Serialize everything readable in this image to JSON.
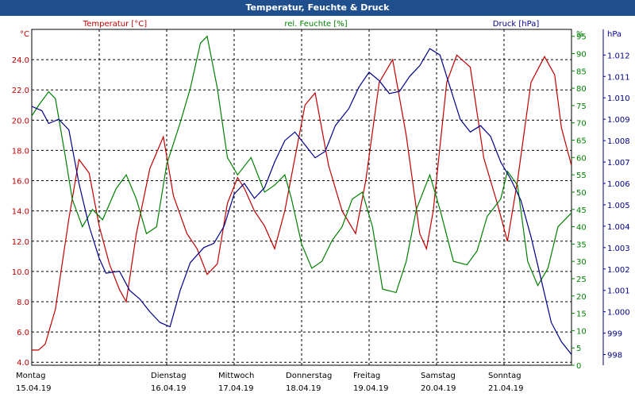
{
  "title": "Temperatur, Feuchte & Druck",
  "chart_data": {
    "type": "line",
    "title": "Temperatur, Feuchte & Druck",
    "axes": {
      "temp": {
        "unit": "°C",
        "label": "Temperatur [°C]",
        "ylim": [
          3.8,
          26.0
        ],
        "ticks": [
          4.0,
          6.0,
          8.0,
          10.0,
          12.0,
          14.0,
          16.0,
          18.0,
          20.0,
          22.0,
          24.0
        ],
        "tick_labels": [
          "4.0",
          "6.0",
          "8.0",
          "10.0",
          "12.0",
          "14.0",
          "16.0",
          "18.0",
          "20.0",
          "22.0",
          "24.0"
        ],
        "color": "#c00000"
      },
      "hum": {
        "unit": "%",
        "label": "rel. Feuchte [%]",
        "ylim": [
          0,
          97
        ],
        "ticks": [
          0,
          5,
          10,
          15,
          20,
          25,
          30,
          35,
          40,
          45,
          50,
          55,
          60,
          65,
          70,
          75,
          80,
          85,
          90,
          95
        ],
        "tick_labels": [
          "0",
          "5",
          "10",
          "15",
          "20",
          "25",
          "30",
          "35",
          "40",
          "45",
          "50",
          "55",
          "60",
          "65",
          "70",
          "75",
          "80",
          "85",
          "90",
          "95"
        ],
        "color": "#008000"
      },
      "press": {
        "unit": "hPa",
        "label": "Druck [hPa]",
        "ylim": [
          997.5,
          1013.2
        ],
        "ticks": [
          998,
          999,
          1000,
          1001,
          1002,
          1003,
          1004,
          1005,
          1006,
          1007,
          1008,
          1009,
          1010,
          1011,
          1012
        ],
        "tick_labels": [
          "998",
          "999",
          "1.000",
          "1.001",
          "1.002",
          "1.003",
          "1.004",
          "1.005",
          "1.006",
          "1.007",
          "1.008",
          "1.009",
          "1.010",
          "1.011",
          "1.012"
        ],
        "color": "#00008b"
      }
    },
    "x_days": [
      {
        "weekday": "Montag",
        "date": "15.04.19"
      },
      {
        "weekday": "Dienstag",
        "date": "16.04.19"
      },
      {
        "weekday": "Mittwoch",
        "date": "17.04.19"
      },
      {
        "weekday": "Donnerstag",
        "date": "18.04.19"
      },
      {
        "weekday": "Freitag",
        "date": "19.04.19"
      },
      {
        "weekday": "Samstag",
        "date": "20.04.19"
      },
      {
        "weekday": "Sonntag",
        "date": "21.04.19"
      }
    ],
    "grid": true,
    "series": [
      {
        "name": "Temperatur [°C]",
        "axis": "temp",
        "color": "#c00000",
        "points": [
          [
            0.0,
            4.8
          ],
          [
            0.1,
            4.8
          ],
          [
            0.2,
            5.2
          ],
          [
            0.35,
            7.5
          ],
          [
            0.55,
            13.5
          ],
          [
            0.7,
            17.4
          ],
          [
            0.85,
            16.5
          ],
          [
            1.0,
            13.0
          ],
          [
            1.15,
            10.5
          ],
          [
            1.3,
            8.8
          ],
          [
            1.4,
            8.0
          ],
          [
            1.55,
            12.5
          ],
          [
            1.75,
            16.8
          ],
          [
            1.95,
            18.9
          ],
          [
            2.1,
            15.0
          ],
          [
            2.3,
            12.5
          ],
          [
            2.45,
            11.5
          ],
          [
            2.6,
            9.8
          ],
          [
            2.75,
            10.5
          ],
          [
            2.9,
            14.5
          ],
          [
            3.05,
            16.2
          ],
          [
            3.15,
            15.5
          ],
          [
            3.3,
            14.0
          ],
          [
            3.45,
            13.0
          ],
          [
            3.6,
            11.5
          ],
          [
            3.75,
            14.0
          ],
          [
            3.9,
            17.5
          ],
          [
            4.05,
            21.0
          ],
          [
            4.2,
            21.8
          ],
          [
            4.4,
            17.0
          ],
          [
            4.6,
            14.0
          ],
          [
            4.8,
            12.5
          ],
          [
            4.95,
            16.0
          ],
          [
            5.15,
            22.5
          ],
          [
            5.35,
            24.0
          ],
          [
            5.55,
            19.0
          ],
          [
            5.75,
            12.5
          ],
          [
            5.85,
            11.5
          ],
          [
            5.95,
            14.0
          ],
          [
            6.15,
            22.5
          ],
          [
            6.3,
            24.3
          ],
          [
            6.5,
            23.5
          ],
          [
            6.7,
            17.5
          ],
          [
            6.9,
            14.5
          ],
          [
            7.05,
            12.0
          ],
          [
            7.2,
            16.0
          ],
          [
            7.4,
            22.5
          ],
          [
            7.6,
            24.2
          ],
          [
            7.75,
            23.0
          ],
          [
            7.85,
            19.5
          ],
          [
            8.0,
            17.0
          ]
        ]
      },
      {
        "name": "rel. Feuchte [%]",
        "axis": "hum",
        "color": "#008000",
        "points": [
          [
            0.0,
            72
          ],
          [
            0.1,
            75
          ],
          [
            0.25,
            79
          ],
          [
            0.35,
            77
          ],
          [
            0.5,
            60
          ],
          [
            0.6,
            48
          ],
          [
            0.75,
            40
          ],
          [
            0.9,
            45
          ],
          [
            1.05,
            42
          ],
          [
            1.25,
            51
          ],
          [
            1.4,
            55
          ],
          [
            1.55,
            48
          ],
          [
            1.7,
            38
          ],
          [
            1.85,
            40
          ],
          [
            2.0,
            58
          ],
          [
            2.2,
            70
          ],
          [
            2.35,
            80
          ],
          [
            2.5,
            93
          ],
          [
            2.6,
            95
          ],
          [
            2.75,
            80
          ],
          [
            2.9,
            60
          ],
          [
            3.05,
            55
          ],
          [
            3.25,
            60
          ],
          [
            3.45,
            50
          ],
          [
            3.6,
            52
          ],
          [
            3.75,
            55
          ],
          [
            3.85,
            48
          ],
          [
            4.0,
            35
          ],
          [
            4.15,
            28
          ],
          [
            4.3,
            30
          ],
          [
            4.45,
            36
          ],
          [
            4.6,
            40
          ],
          [
            4.75,
            48
          ],
          [
            4.9,
            50
          ],
          [
            5.05,
            40
          ],
          [
            5.2,
            22
          ],
          [
            5.4,
            21
          ],
          [
            5.55,
            30
          ],
          [
            5.7,
            45
          ],
          [
            5.9,
            55
          ],
          [
            6.05,
            45
          ],
          [
            6.25,
            30
          ],
          [
            6.45,
            29
          ],
          [
            6.6,
            33
          ],
          [
            6.75,
            43
          ],
          [
            6.95,
            48
          ],
          [
            7.05,
            56
          ],
          [
            7.2,
            52
          ],
          [
            7.35,
            30
          ],
          [
            7.5,
            23
          ],
          [
            7.65,
            28
          ],
          [
            7.8,
            40
          ],
          [
            8.0,
            44
          ]
        ]
      },
      {
        "name": "Druck [hPa]",
        "axis": "press",
        "color": "#00008b",
        "points": [
          [
            0.0,
            1009.6
          ],
          [
            0.15,
            1009.4
          ],
          [
            0.25,
            1008.8
          ],
          [
            0.4,
            1009.0
          ],
          [
            0.55,
            1008.5
          ],
          [
            0.7,
            1006.0
          ],
          [
            0.85,
            1004.0
          ],
          [
            1.0,
            1002.5
          ],
          [
            1.1,
            1001.8
          ],
          [
            1.3,
            1001.9
          ],
          [
            1.45,
            1001.0
          ],
          [
            1.6,
            1000.6
          ],
          [
            1.75,
            1000.0
          ],
          [
            1.9,
            999.5
          ],
          [
            2.05,
            999.3
          ],
          [
            2.2,
            1001.0
          ],
          [
            2.35,
            1002.3
          ],
          [
            2.55,
            1003.0
          ],
          [
            2.7,
            1003.2
          ],
          [
            2.85,
            1004.0
          ],
          [
            3.0,
            1005.5
          ],
          [
            3.15,
            1006.0
          ],
          [
            3.3,
            1005.3
          ],
          [
            3.45,
            1005.8
          ],
          [
            3.6,
            1007.0
          ],
          [
            3.75,
            1008.0
          ],
          [
            3.9,
            1008.4
          ],
          [
            4.05,
            1007.8
          ],
          [
            4.2,
            1007.2
          ],
          [
            4.35,
            1007.5
          ],
          [
            4.5,
            1008.7
          ],
          [
            4.7,
            1009.5
          ],
          [
            4.85,
            1010.5
          ],
          [
            5.0,
            1011.2
          ],
          [
            5.15,
            1010.8
          ],
          [
            5.3,
            1010.2
          ],
          [
            5.45,
            1010.3
          ],
          [
            5.6,
            1011.0
          ],
          [
            5.75,
            1011.5
          ],
          [
            5.9,
            1012.3
          ],
          [
            6.05,
            1012.0
          ],
          [
            6.2,
            1010.5
          ],
          [
            6.35,
            1009.0
          ],
          [
            6.5,
            1008.4
          ],
          [
            6.65,
            1008.7
          ],
          [
            6.8,
            1008.2
          ],
          [
            6.95,
            1007.0
          ],
          [
            7.1,
            1006.2
          ],
          [
            7.25,
            1005.2
          ],
          [
            7.4,
            1003.5
          ],
          [
            7.55,
            1001.5
          ],
          [
            7.7,
            999.5
          ],
          [
            7.85,
            998.6
          ],
          [
            8.0,
            998.0
          ]
        ]
      }
    ]
  }
}
